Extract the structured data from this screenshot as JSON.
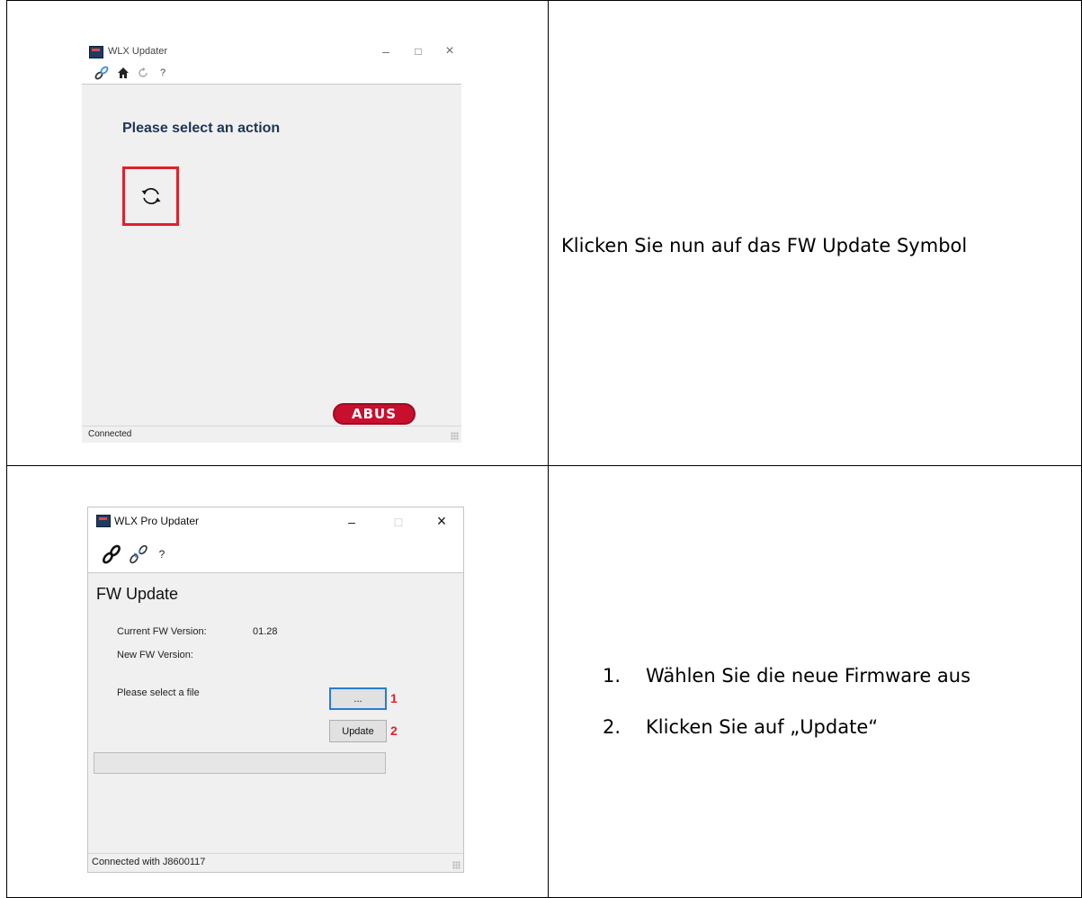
{
  "step1": {
    "window_title": "WLX Updater",
    "controls": {
      "minimize": "–",
      "maximize": "□",
      "close": "×"
    },
    "toolbar": [
      {
        "icon": "link-icon"
      },
      {
        "icon": "home-icon"
      },
      {
        "icon": "refresh-icon"
      },
      {
        "label": "?"
      }
    ],
    "heading": "Please select an action",
    "action_icon": "fw-update-icon",
    "logo_text": "ABUS",
    "status": "Connected",
    "instruction": "Klicken Sie nun auf das FW Update Symbol"
  },
  "step2": {
    "window_title": "WLX Pro Updater",
    "controls": {
      "minimize": "–",
      "maximize": "□",
      "close": "×"
    },
    "toolbar": [
      {
        "icon": "link-icon"
      },
      {
        "icon": "link-broken-icon"
      },
      {
        "label": "?"
      }
    ],
    "heading": "FW Update",
    "current_fw_label": "Current FW Version:",
    "current_fw_value": "01.28",
    "new_fw_label": "New FW Version:",
    "select_file_label": "Please select a file",
    "browse_button": "...",
    "update_button": "Update",
    "marker_1": "1",
    "marker_2": "2",
    "progress": 0,
    "status": "Connected with J8600117",
    "instructions": [
      {
        "num": "1.",
        "text": "Wählen Sie die neue Firmware aus"
      },
      {
        "num": "2.",
        "text": "Klicken Sie auf „Update“"
      }
    ]
  }
}
